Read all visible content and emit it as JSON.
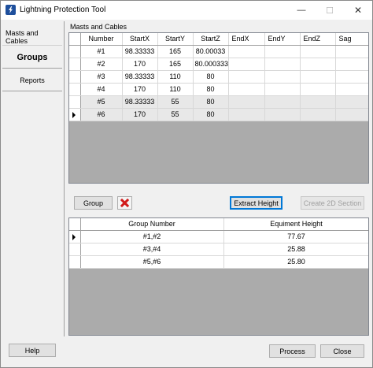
{
  "window": {
    "title": "Lightning Protection Tool",
    "controls": {
      "minimize": "—",
      "maximize": "☐",
      "close": "✕"
    }
  },
  "sidebar": {
    "items": [
      {
        "label": "Masts and Cables"
      },
      {
        "label": "Groups"
      },
      {
        "label": "Reports"
      }
    ]
  },
  "masts": {
    "section_label": "Masts and Cables",
    "columns": [
      "Number",
      "StartX",
      "StartY",
      "StartZ",
      "EndX",
      "EndY",
      "EndZ",
      "Sag"
    ],
    "rows": [
      [
        "#1",
        "98.33333",
        "165",
        "80.00033",
        "",
        "",
        "",
        ""
      ],
      [
        "#2",
        "170",
        "165",
        "80.000333",
        "",
        "",
        "",
        ""
      ],
      [
        "#3",
        "98.33333",
        "110",
        "80",
        "",
        "",
        "",
        ""
      ],
      [
        "#4",
        "170",
        "110",
        "80",
        "",
        "",
        "",
        ""
      ],
      [
        "#5",
        "98.33333",
        "55",
        "80",
        "",
        "",
        "",
        ""
      ],
      [
        "#6",
        "170",
        "55",
        "80",
        "",
        "",
        "",
        ""
      ]
    ]
  },
  "toolbar": {
    "group_label": "Group",
    "delete_icon": "red-x-icon",
    "extract_label": "Extract Height",
    "create2d_label": "Create 2D Section"
  },
  "groups": {
    "columns": [
      "Group Number",
      "Equiment Height"
    ],
    "rows": [
      [
        "#1,#2",
        "77.67"
      ],
      [
        "#3,#4",
        "25.88"
      ],
      [
        "#5,#6",
        "25.80"
      ]
    ]
  },
  "footer": {
    "help_label": "Help",
    "process_label": "Process",
    "close_label": "Close"
  },
  "colors": {
    "focus_border": "#0078d7",
    "delete_red": "#d11a1a",
    "grid_background": "#ababab"
  }
}
